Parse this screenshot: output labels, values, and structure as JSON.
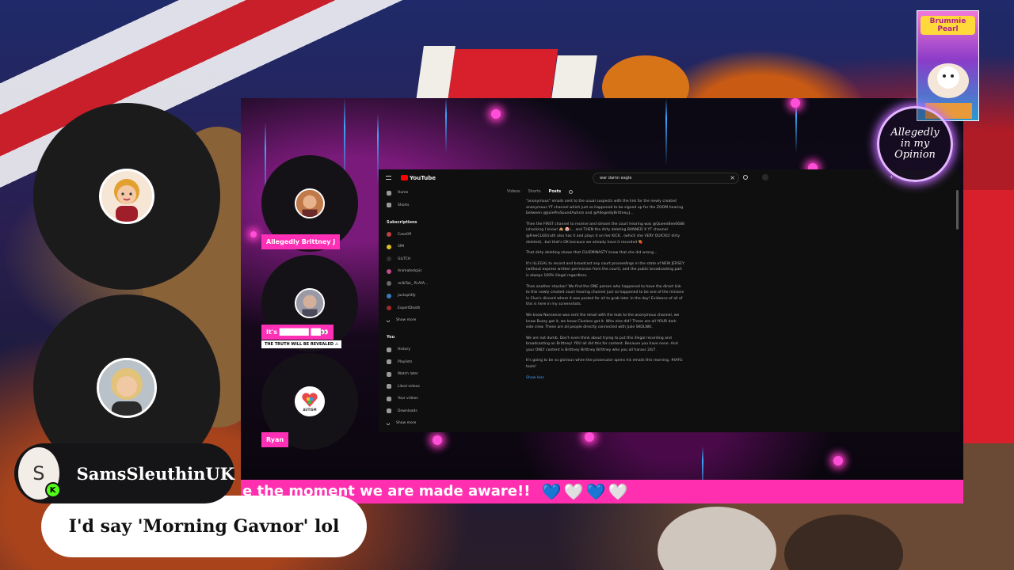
{
  "stream": {
    "ticker_text": "e the moment we are made aware!!",
    "ticker_hearts": [
      "💙",
      "🤍",
      "💙",
      "🤍"
    ]
  },
  "guests": [
    {
      "tag": "Allegedly Brittney J"
    },
    {
      "tag": "It's ██████ ██👀",
      "subtag": "THE TRUTH WILL BE REVEALED ⚠"
    },
    {
      "tag": "Ryan",
      "avatar_text": "AUTISM"
    }
  ],
  "youtube": {
    "brand": "YouTube",
    "search_query": "war damn eagle",
    "tabs": [
      "Videos",
      "Shorts",
      "Posts"
    ],
    "sidebar": {
      "top": [
        "Home",
        "Shorts"
      ],
      "subscriptions_label": "Subscriptions",
      "subscriptions": [
        "CaseOfi",
        "SMI",
        "GLITCH",
        "Animatedcpic",
        "milkTok_ PLAYA...",
        "jacksplitfy",
        "ExpertDeath",
        "Show more"
      ],
      "you_label": "You",
      "you": [
        "History",
        "Playlists",
        "Watch later",
        "Liked videos",
        "Your videos",
        "Downloads",
        "Show more"
      ]
    },
    "post_paragraphs": [
      "\"anonymous\" emails sent to the usual suspects with the link for the newly created anonymous YT channel which just so happened to be signed up for the ZOOM hearing between @JulieProSoundAutism and @AllegedlyBrittney.J...",
      "Then the FIRST channel to receive and stream the court hearing was @QueenBee0688 (shocking I know! 🙈 🤡)... and THEN the dirty deleting BANNED X YT channel @FreeCLUEtruth also has it and plays it on her KICK.. (which she VERY QUICKLY dirty deleted).. but that's OK because we already have it recorded 🍓",
      "That dirty deleting shows that CLUEMINASTY knew that she did wrong...",
      "It's ILLEGAL to record and broadcast any court proceedings in the state of NEW JERSEY (without express written permission from the court), and the public broadcasting part is always 100% illegal regardless.",
      "Then another shocker! We find the ONE person who happened to have the direct link to this newly created court hearing channel just so happened to be one of the minions in Clue's discord where it was posted for all to grab later in the day! Evidence of all of this is here in my screenshots.",
      "We know Nonsense was sent the email with the leak to the anonymous channel, we know Buzzy got it, we know Clueless got it. Who else did? These are all YOUR dark side crew. These are all people directly connected with Julie SKOLNIK.",
      "We are not dumb. Don't even think about trying to put this illegal recording and broadcasting on Brittney! YOU all did this for content. Because you have none. And your ONLY content is Brittney Brittney Brittney who you all harass 24/7.",
      "It's going to be so glorious when the prosecutor opens his emails this morning. #IAFG tools!",
      "Show less"
    ]
  },
  "chat": {
    "username": "SamsSleuthinUK",
    "avatar_letter": "S",
    "badge": "K",
    "message": "I'd say 'Morning Gavnor' lol"
  },
  "branding": {
    "poster_title": "Brummie Pearl",
    "emblem_text": "Allegedly in my Opinion"
  }
}
